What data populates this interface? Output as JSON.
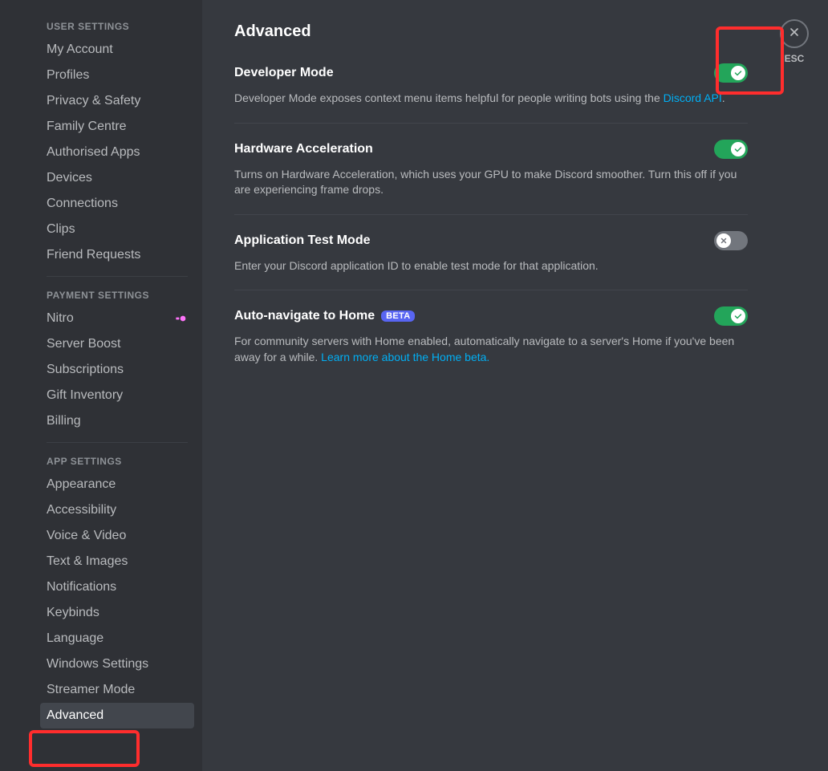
{
  "sidebar": {
    "sections": [
      {
        "heading": "USER SETTINGS",
        "items": [
          {
            "key": "my-account",
            "label": "My Account"
          },
          {
            "key": "profiles",
            "label": "Profiles"
          },
          {
            "key": "privacy-safety",
            "label": "Privacy & Safety"
          },
          {
            "key": "family-centre",
            "label": "Family Centre"
          },
          {
            "key": "authorised-apps",
            "label": "Authorised Apps"
          },
          {
            "key": "devices",
            "label": "Devices"
          },
          {
            "key": "connections",
            "label": "Connections"
          },
          {
            "key": "clips",
            "label": "Clips"
          },
          {
            "key": "friend-requests",
            "label": "Friend Requests"
          }
        ]
      },
      {
        "heading": "PAYMENT SETTINGS",
        "items": [
          {
            "key": "nitro",
            "label": "Nitro",
            "hasNitroIcon": true
          },
          {
            "key": "server-boost",
            "label": "Server Boost"
          },
          {
            "key": "subscriptions",
            "label": "Subscriptions"
          },
          {
            "key": "gift-inventory",
            "label": "Gift Inventory"
          },
          {
            "key": "billing",
            "label": "Billing"
          }
        ]
      },
      {
        "heading": "APP SETTINGS",
        "items": [
          {
            "key": "appearance",
            "label": "Appearance"
          },
          {
            "key": "accessibility",
            "label": "Accessibility"
          },
          {
            "key": "voice-video",
            "label": "Voice & Video"
          },
          {
            "key": "text-images",
            "label": "Text & Images"
          },
          {
            "key": "notifications",
            "label": "Notifications"
          },
          {
            "key": "keybinds",
            "label": "Keybinds"
          },
          {
            "key": "language",
            "label": "Language"
          },
          {
            "key": "windows-settings",
            "label": "Windows Settings"
          },
          {
            "key": "streamer-mode",
            "label": "Streamer Mode"
          },
          {
            "key": "advanced",
            "label": "Advanced",
            "active": true
          }
        ]
      }
    ]
  },
  "page": {
    "title": "Advanced",
    "closeLabel": "ESC"
  },
  "settings": [
    {
      "key": "developer-mode",
      "title": "Developer Mode",
      "descPrefix": "Developer Mode exposes context menu items helpful for people writing bots using the ",
      "linkText": "Discord API",
      "descSuffix": ".",
      "on": true,
      "badge": null
    },
    {
      "key": "hardware-accel",
      "title": "Hardware Acceleration",
      "descPrefix": "Turns on Hardware Acceleration, which uses your GPU to make Discord smoother. Turn this off if you are experiencing frame drops.",
      "linkText": null,
      "descSuffix": "",
      "on": true,
      "badge": null
    },
    {
      "key": "app-test-mode",
      "title": "Application Test Mode",
      "descPrefix": "Enter your Discord application ID to enable test mode for that application.",
      "linkText": null,
      "descSuffix": "",
      "on": false,
      "badge": null
    },
    {
      "key": "auto-home",
      "title": "Auto-navigate to Home",
      "descPrefix": "For community servers with Home enabled, automatically navigate to a server's Home if you've been away for a while. ",
      "linkText": "Learn more about the Home beta.",
      "descSuffix": "",
      "on": true,
      "badge": "BETA"
    }
  ]
}
